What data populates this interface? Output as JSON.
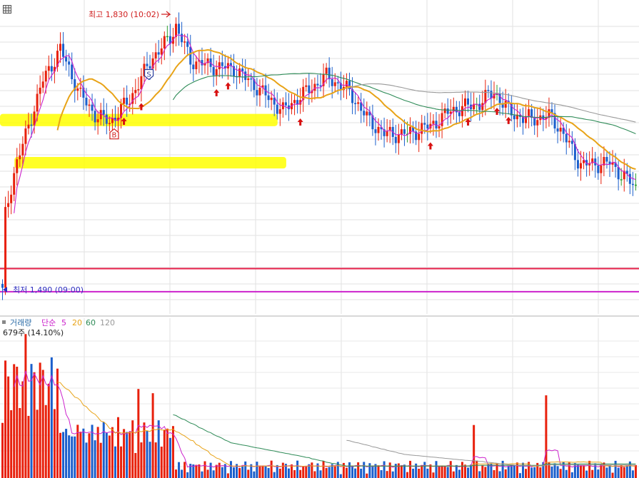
{
  "chart_data": [
    {
      "type": "candlestick",
      "panel": "price",
      "ylim": [
        1470,
        1850
      ],
      "grid": true,
      "high_annotation": {
        "text": "최고 1,830 (10:02)",
        "value": 1830
      },
      "low_annotation": {
        "text": "최저 1,490 (09:00)",
        "value": 1490
      },
      "horizontal_lines": [
        {
          "value": 1515,
          "color": "#e8204a"
        },
        {
          "value": 1485,
          "color": "#cc22cc"
        }
      ],
      "highlight_bands": [
        {
          "from": 1700,
          "to": 1716,
          "x_start_index": 0,
          "x_end_index": 95,
          "color": "#ffff00"
        },
        {
          "from": 1645,
          "to": 1660,
          "x_start_index": 5,
          "x_end_index": 98,
          "color": "#ffff00"
        }
      ],
      "moving_averages": [
        {
          "period": 5,
          "color": "#cc22cc"
        },
        {
          "period": 20,
          "color": "#e8a317"
        },
        {
          "period": 60,
          "color": "#2e8b57"
        },
        {
          "period": 120,
          "color": "#999999"
        }
      ],
      "signal_markers": [
        {
          "label": "S",
          "index": 51,
          "value": 1768
        },
        {
          "label": "B",
          "index": 39,
          "value": 1689
        }
      ],
      "arrow_indices": [
        42,
        48,
        74,
        78,
        103,
        148,
        161,
        171,
        175
      ],
      "colors": {
        "up": "#e8200c",
        "down": "#1b5fcc",
        "neutral": "#2ea02e"
      }
    },
    {
      "type": "bar",
      "panel": "volume",
      "title": "거래량",
      "legend_label": "단순",
      "legend_periods": [
        "5",
        "20",
        "60",
        "120"
      ],
      "legend_colors": [
        "#cc22cc",
        "#e8a317",
        "#2e8b57",
        "#999999"
      ],
      "max_label": "679주 (14.10%)",
      "ylim": [
        0,
        700
      ]
    }
  ]
}
